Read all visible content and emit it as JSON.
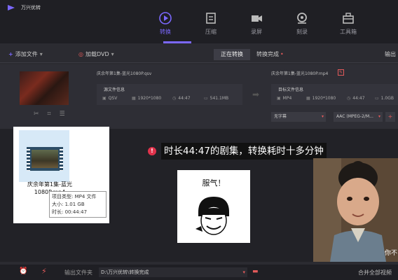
{
  "app": {
    "name": "万兴优转"
  },
  "nav": {
    "tabs": [
      {
        "label": "转换",
        "icon": "convert-icon",
        "active": true
      },
      {
        "label": "压缩",
        "icon": "compress-icon",
        "active": false
      },
      {
        "label": "录屏",
        "icon": "record-icon",
        "active": false
      },
      {
        "label": "刻录",
        "icon": "burn-icon",
        "active": false
      },
      {
        "label": "工具箱",
        "icon": "toolbox-icon",
        "active": false
      }
    ]
  },
  "toolbar": {
    "add_file": "添加文件",
    "load_dvd": "加载DVD",
    "converting": "正在转换",
    "done": "转换完成",
    "output": "输出"
  },
  "file": {
    "src_name": "庆余年第1集-蓝光1080P.qsv",
    "src_title": "源文件信息",
    "src_format": "QSV",
    "src_resolution": "1920*1080",
    "src_duration": "44:47",
    "src_size": "541.1MB",
    "dst_name": "庆余年第1集-蓝光1080P.mp4",
    "dst_title": "目标文件信息",
    "dst_format": "MP4",
    "dst_resolution": "1920*1080",
    "dst_duration": "44:47",
    "dst_size": "1.0GB",
    "subtitle": "无字幕",
    "audio": "AAC (MPEG-2/M..."
  },
  "overlay": {
    "file_label": "庆余年第1集-蓝光1080P.mp4",
    "tooltip": [
      "项目类型: MP4 文件",
      "大小: 1.01 GB",
      "时长: 00:44:47"
    ],
    "caption": "时长44:47的剧集，转换耗时十多分钟",
    "meme_text": "服气！",
    "video_subtitle": "你不"
  },
  "bottom": {
    "output_label": "输出文件夹",
    "output_path": "D:\\万兴优转\\转换完成",
    "merge": "合并全部视频"
  },
  "colors": {
    "accent": "#7b68ff",
    "red": "#e35a5a"
  }
}
